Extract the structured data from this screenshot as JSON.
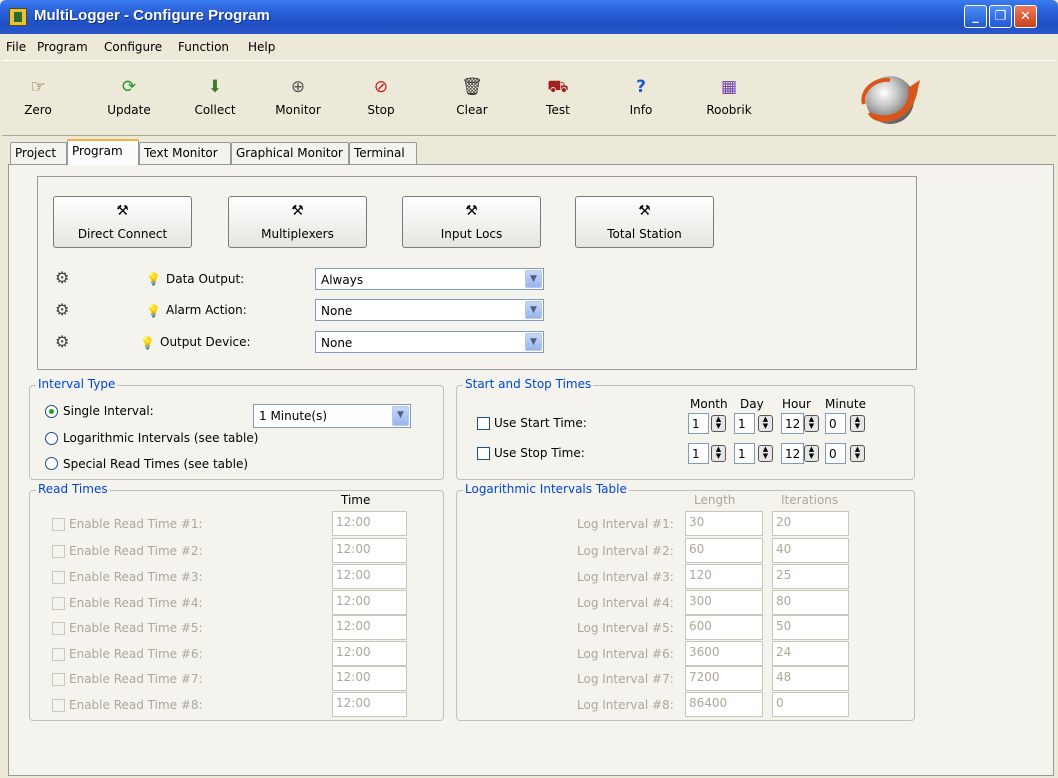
{
  "window": {
    "title": "MultiLogger - Configure Program",
    "controls": [
      "_",
      "❐",
      "✕"
    ]
  },
  "menu": [
    "File",
    "Program",
    "Configure",
    "Function",
    "Help"
  ],
  "toolbar": [
    {
      "label": "Zero",
      "icon": "zero-icon"
    },
    {
      "label": "Update",
      "icon": "update-icon"
    },
    {
      "label": "Collect",
      "icon": "collect-icon"
    },
    {
      "label": "Monitor",
      "icon": "monitor-icon"
    },
    {
      "label": "Stop",
      "icon": "stop-icon"
    },
    {
      "label": "Clear",
      "icon": "clear-icon"
    },
    {
      "label": "Test",
      "icon": "test-icon"
    },
    {
      "label": "Info",
      "icon": "info-icon"
    },
    {
      "label": "Roobrik",
      "icon": "roobrik-icon"
    }
  ],
  "tabs": [
    "Project",
    "Program",
    "Text Monitor",
    "Graphical Monitor",
    "Terminal"
  ],
  "active_tab": "Program",
  "connection_buttons": [
    "Direct Connect",
    "Multiplexers",
    "Input Locs",
    "Total Station"
  ],
  "output_settings": [
    {
      "label": "Data Output:",
      "value": "Always"
    },
    {
      "label": "Alarm Action:",
      "value": "None"
    },
    {
      "label": "Output Device:",
      "value": "None"
    }
  ],
  "interval_type": {
    "title": "Interval Type",
    "options": [
      "Single Interval:",
      "Logarithmic Intervals (see table)",
      "Special Read Times (see table)"
    ],
    "selected": 0,
    "single_interval_value": "1 Minute(s)"
  },
  "start_stop": {
    "title": "Start and Stop Times",
    "headers": [
      "Month",
      "Day",
      "Hour",
      "Minute"
    ],
    "rows": [
      {
        "label": "Use Start Time:",
        "checked": false,
        "values": [
          "1",
          "1",
          "12",
          "0"
        ]
      },
      {
        "label": "Use Stop Time:",
        "checked": false,
        "values": [
          "1",
          "1",
          "12",
          "0"
        ]
      }
    ]
  },
  "read_times": {
    "title": "Read Times",
    "column_header": "Time",
    "rows": [
      {
        "label": "Enable Read Time #1:",
        "time": "12:00"
      },
      {
        "label": "Enable Read Time #2:",
        "time": "12:00"
      },
      {
        "label": "Enable Read Time #3:",
        "time": "12:00"
      },
      {
        "label": "Enable Read Time #4:",
        "time": "12:00"
      },
      {
        "label": "Enable Read Time #5:",
        "time": "12:00"
      },
      {
        "label": "Enable Read Time #6:",
        "time": "12:00"
      },
      {
        "label": "Enable Read Time #7:",
        "time": "12:00"
      },
      {
        "label": "Enable Read Time #8:",
        "time": "12:00"
      }
    ]
  },
  "log_table": {
    "title": "Logarithmic Intervals Table",
    "headers": [
      "Length",
      "Iterations"
    ],
    "rows": [
      {
        "label": "Log Interval #1:",
        "length": "30",
        "iterations": "20"
      },
      {
        "label": "Log Interval #2:",
        "length": "60",
        "iterations": "40"
      },
      {
        "label": "Log Interval #3:",
        "length": "120",
        "iterations": "25"
      },
      {
        "label": "Log Interval #4:",
        "length": "300",
        "iterations": "80"
      },
      {
        "label": "Log Interval #5:",
        "length": "600",
        "iterations": "50"
      },
      {
        "label": "Log Interval #6:",
        "length": "3600",
        "iterations": "24"
      },
      {
        "label": "Log Interval #7:",
        "length": "7200",
        "iterations": "48"
      },
      {
        "label": "Log Interval #8:",
        "length": "86400",
        "iterations": "0"
      }
    ]
  }
}
